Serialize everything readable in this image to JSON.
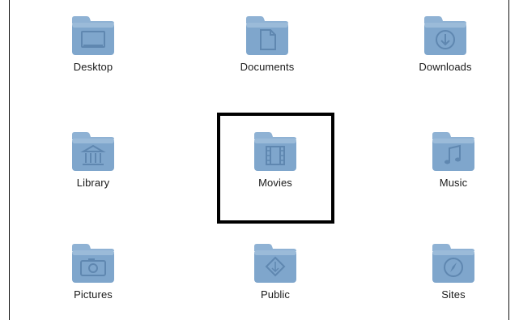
{
  "folders": [
    {
      "label": "Desktop",
      "icon": "desktop-icon"
    },
    {
      "label": "Documents",
      "icon": "document-icon"
    },
    {
      "label": "Downloads",
      "icon": "download-icon"
    },
    {
      "label": "Library",
      "icon": "library-icon"
    },
    {
      "label": "Movies",
      "icon": "film-icon"
    },
    {
      "label": "Music",
      "icon": "music-note-icon"
    },
    {
      "label": "Pictures",
      "icon": "camera-icon"
    },
    {
      "label": "Public",
      "icon": "public-icon"
    },
    {
      "label": "Sites",
      "icon": "compass-icon"
    }
  ],
  "selected": "Movies",
  "colors": {
    "folder_body": "#7fa6cc",
    "folder_tab": "#8fb2d4",
    "folder_emboss": "#5f87b0",
    "highlight_border": "#000000"
  }
}
